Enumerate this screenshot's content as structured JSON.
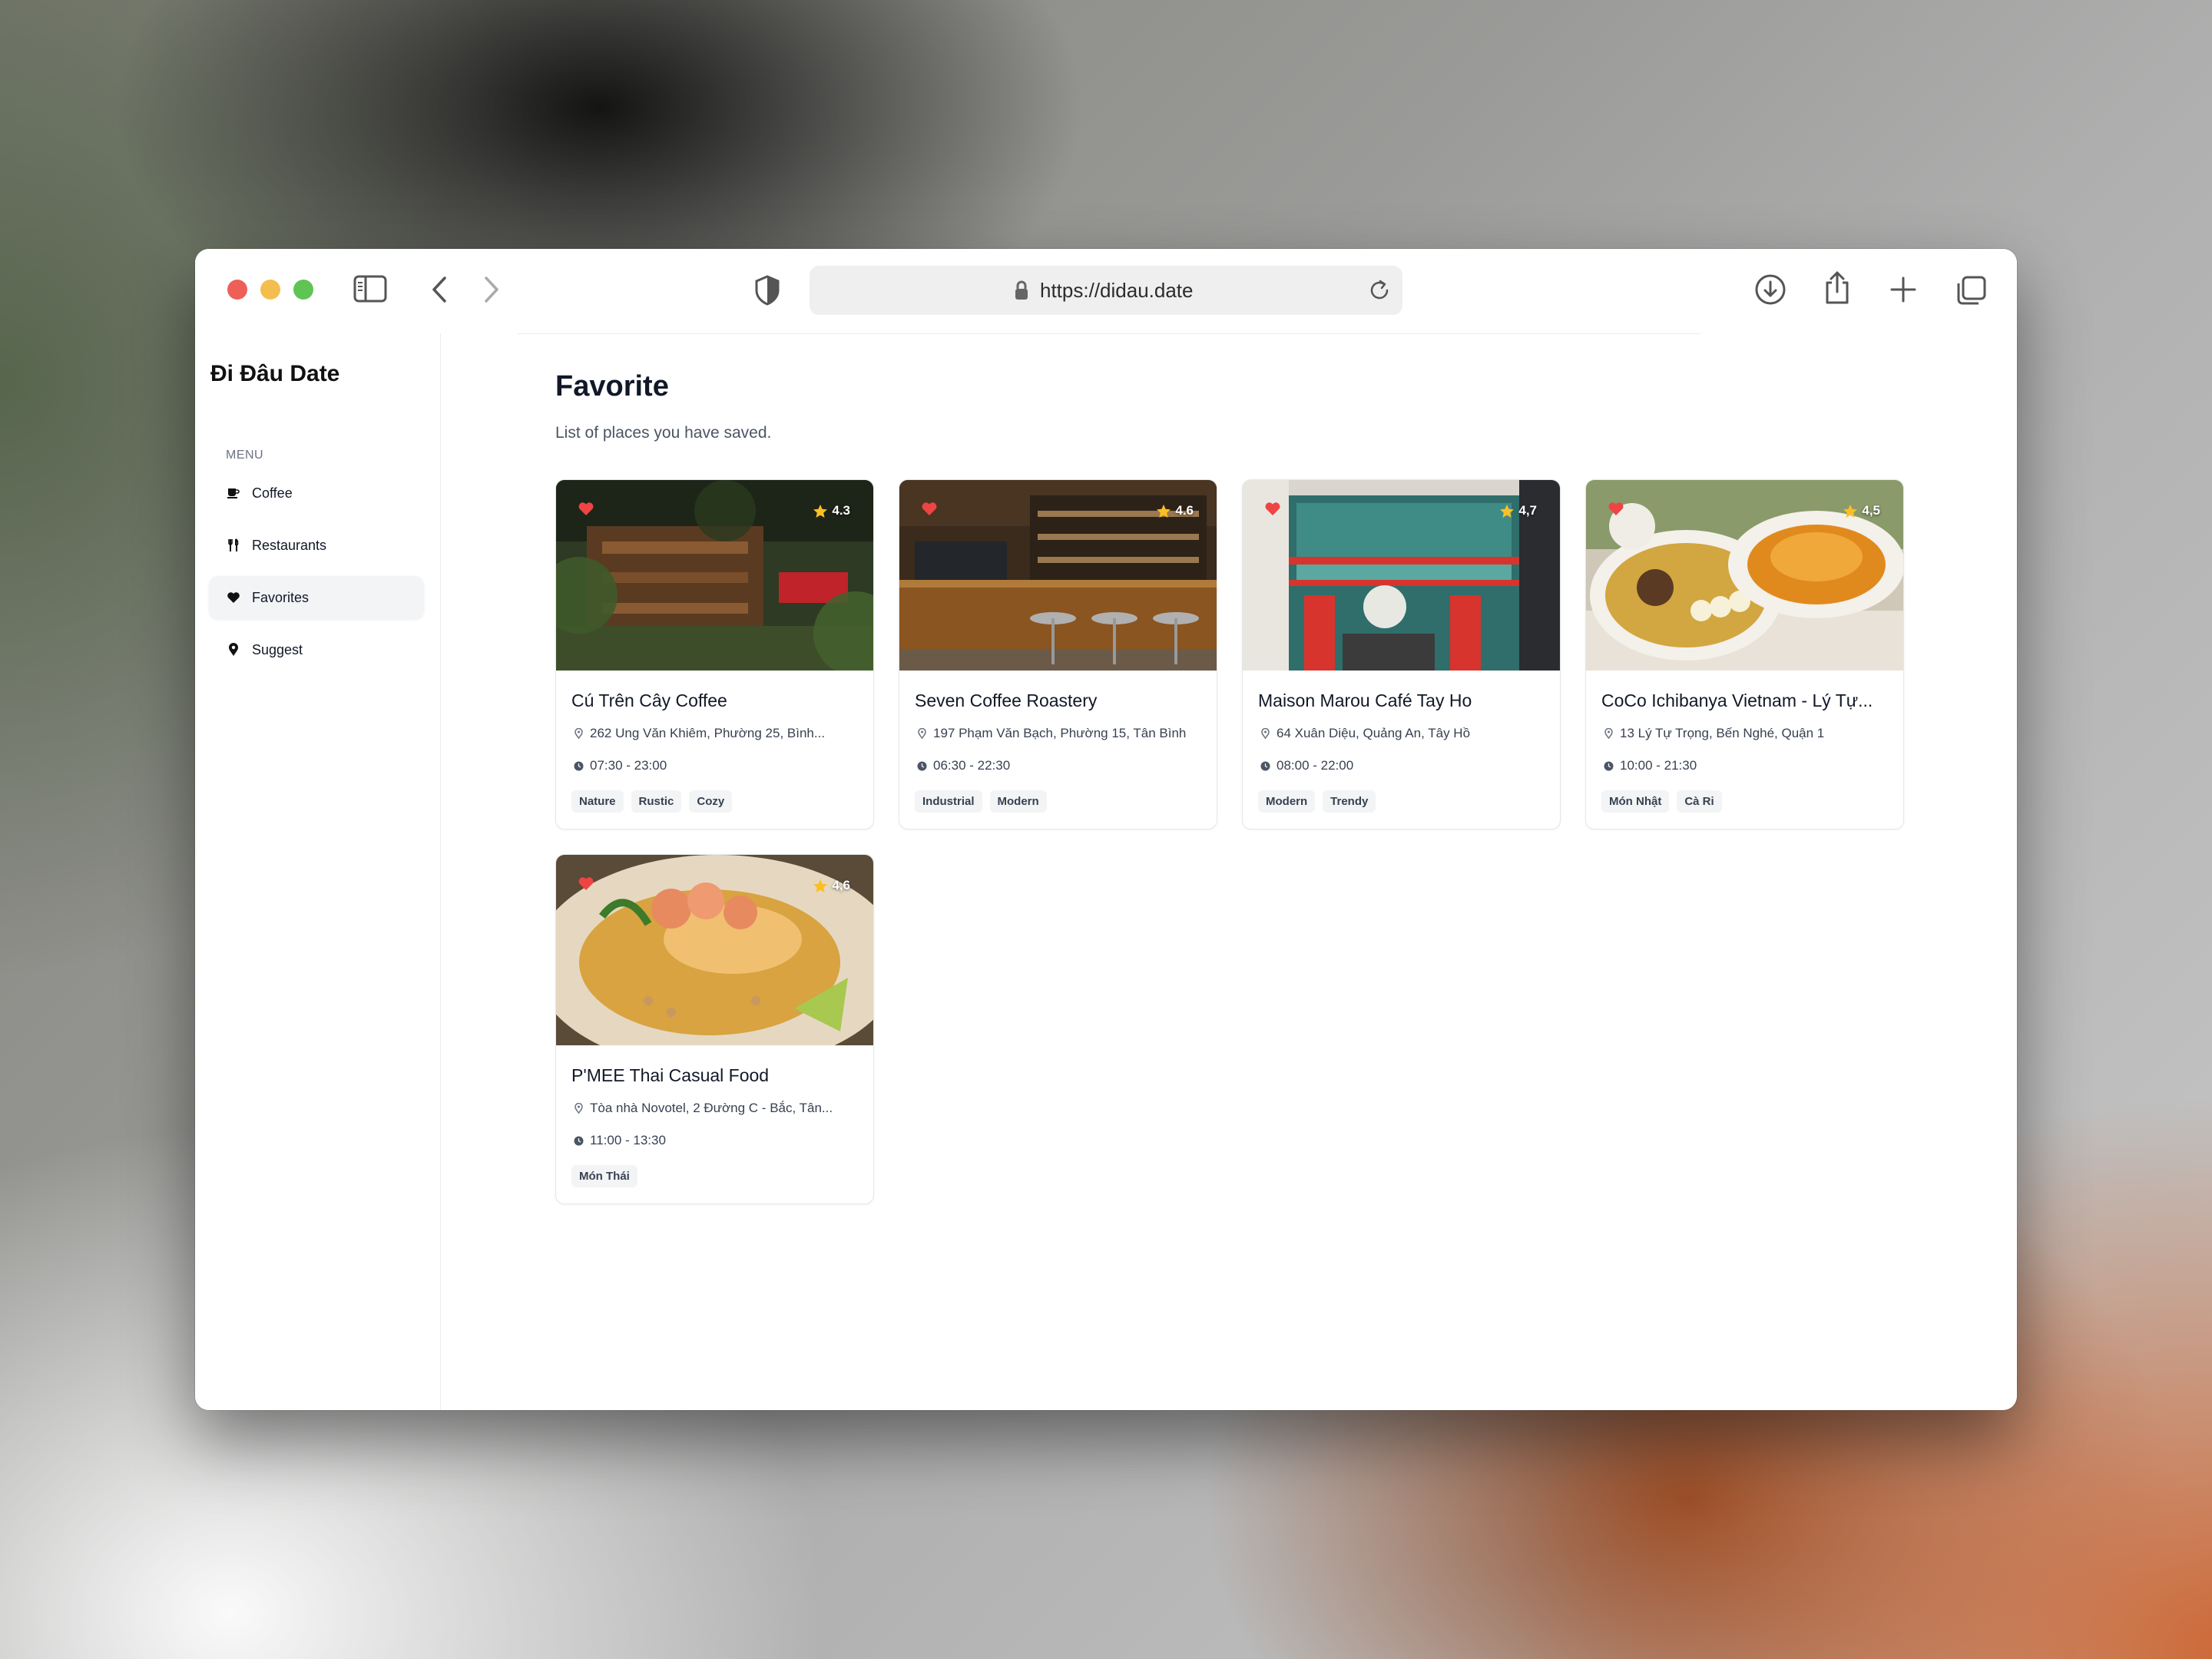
{
  "browser": {
    "url": "https://didau.date"
  },
  "sidebar": {
    "brand": "Đi Đâu Date",
    "menu_label": "MENU",
    "items": [
      {
        "label": "Coffee",
        "icon": "coffee-icon"
      },
      {
        "label": "Restaurants",
        "icon": "utensils-icon"
      },
      {
        "label": "Favorites",
        "icon": "heart-icon",
        "active": true
      },
      {
        "label": "Suggest",
        "icon": "map-pin-icon"
      }
    ]
  },
  "main": {
    "title": "Favorite",
    "subtitle": "List of places you have saved.",
    "cards": [
      {
        "name": "Cú Trên Cây Coffee",
        "rating": "4.3",
        "address": "262 Ung Văn Khiêm, Phường 25, Bình...",
        "hours": "07:30 - 23:00",
        "tags": [
          "Nature",
          "Rustic",
          "Cozy"
        ]
      },
      {
        "name": "Seven Coffee Roastery",
        "rating": "4.6",
        "address": "197 Phạm Văn Bạch, Phường 15, Tân Bình",
        "hours": "06:30 - 22:30",
        "tags": [
          "Industrial",
          "Modern"
        ]
      },
      {
        "name": "Maison Marou Café Tay Ho",
        "rating": "4,7",
        "address": "64 Xuân Diệu, Quảng An, Tây Hồ",
        "hours": "08:00 - 22:00",
        "tags": [
          "Modern",
          "Trendy"
        ]
      },
      {
        "name": "CoCo Ichibanya Vietnam - Lý Tự...",
        "rating": "4,5",
        "address": "13 Lý Tự Trọng, Bến Nghé, Quận 1",
        "hours": "10:00 - 21:30",
        "tags": [
          "Món Nhật",
          "Cà Ri"
        ]
      },
      {
        "name": "P'MEE Thai Casual Food",
        "rating": "4,6",
        "address": "Tòa nhà Novotel, 2 Đường C - Bắc, Tân...",
        "hours": "11:00 - 13:30",
        "tags": [
          "Món Thái"
        ]
      }
    ]
  },
  "colors": {
    "accent_heart": "#ef4444",
    "star": "#fbbf24",
    "text_primary": "#111827"
  }
}
